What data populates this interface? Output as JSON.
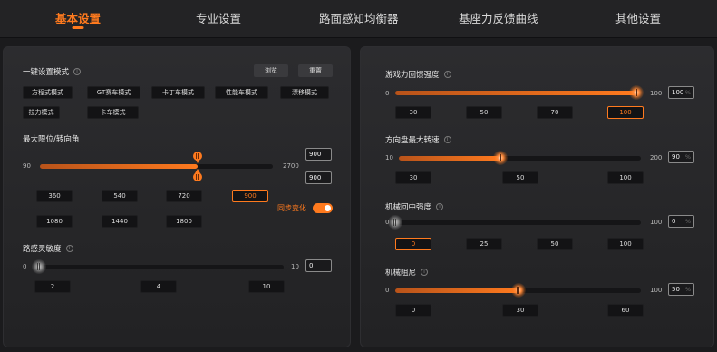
{
  "tabs": {
    "basic": "基本设置",
    "professional": "专业设置",
    "road_feel_equalizer": "路面感知均衡器",
    "base_force_curve": "基座力反馈曲线",
    "other": "其他设置",
    "active": "基本设置"
  },
  "left": {
    "one_key_mode": {
      "title": "一键设置模式",
      "browse_label": "浏览",
      "reset_label": "重置",
      "modes": [
        "方程式模式",
        "GT赛车模式",
        "卡丁车模式",
        "性能车模式",
        "漂移模式",
        "拉力模式",
        "卡车模式"
      ]
    },
    "max_angle": {
      "title": "最大限位/转向角",
      "min_label": "90",
      "max_label": "2700",
      "min_value": 90,
      "max_value": 2700,
      "left_value": 900,
      "right_value": 900,
      "left_input": "900",
      "right_input": "900",
      "presets": [
        "360",
        "540",
        "720",
        "900",
        "1080",
        "1440",
        "1800"
      ],
      "active_preset": "900",
      "sync_label": "同步变化",
      "sync_on": true
    },
    "road_sensitivity": {
      "title": "路感灵敏度",
      "min_label": "0",
      "max_label": "10",
      "min_value": 0,
      "max_value": 10,
      "value": 0,
      "input": "0",
      "presets": [
        "2",
        "4",
        "10"
      ]
    }
  },
  "right": {
    "game_ffb_strength": {
      "title": "游戏力回馈强度",
      "min_label": "0",
      "max_label": "100",
      "min_value": 0,
      "max_value": 100,
      "value": 100,
      "input": "100",
      "unit": "%",
      "presets": [
        "30",
        "50",
        "70",
        "100"
      ],
      "active_preset": "100"
    },
    "max_wheel_speed": {
      "title": "方向盘最大转速",
      "min_label": "10",
      "max_label": "200",
      "min_value": 10,
      "max_value": 200,
      "value": 90,
      "input": "90",
      "unit": "%",
      "presets": [
        "30",
        "50",
        "100"
      ]
    },
    "mech_center_strength": {
      "title": "机械回中强度",
      "min_label": "0",
      "max_label": "100",
      "min_value": 0,
      "max_value": 100,
      "value": 0,
      "input": "0",
      "unit": "%",
      "presets": [
        "0",
        "25",
        "50",
        "100"
      ],
      "active_preset": "0"
    },
    "mech_damping": {
      "title": "机械阻尼",
      "min_label": "0",
      "max_label": "100",
      "min_value": 0,
      "max_value": 100,
      "value": 50,
      "input": "50",
      "unit": "%",
      "presets": [
        "0",
        "30",
        "60"
      ]
    }
  },
  "info_icon_glyph": "i",
  "colors": {
    "accent": "#ff7a1e",
    "background": "#1b1b1d",
    "panel": "#2a2a2c",
    "pill": "#131315"
  }
}
